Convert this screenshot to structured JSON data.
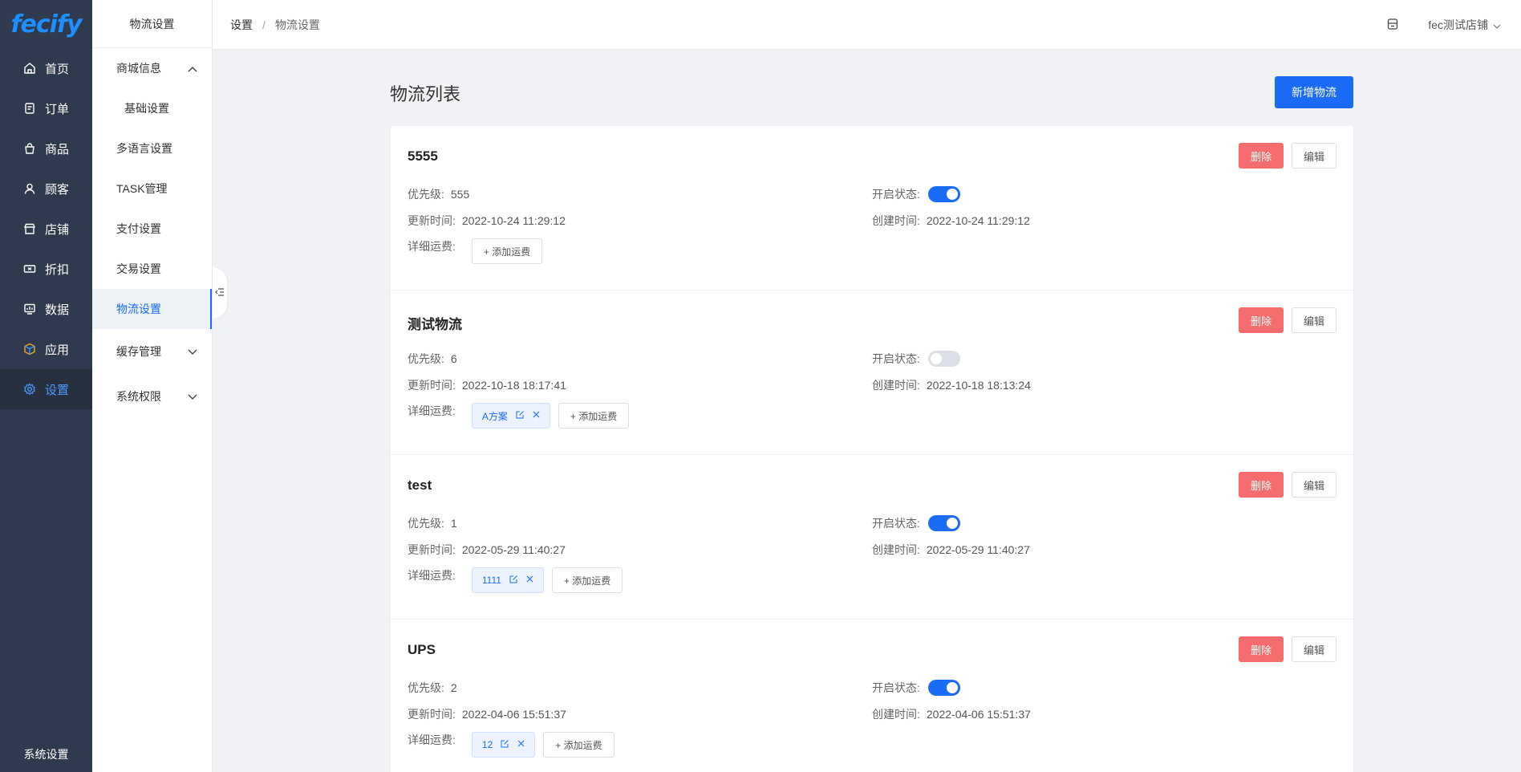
{
  "nav": {
    "logo": "fecify",
    "items": [
      {
        "label": "首页",
        "icon": "home-icon"
      },
      {
        "label": "订单",
        "icon": "order-icon"
      },
      {
        "label": "商品",
        "icon": "bag-icon"
      },
      {
        "label": "顾客",
        "icon": "user-icon"
      },
      {
        "label": "店铺",
        "icon": "store-icon"
      },
      {
        "label": "折扣",
        "icon": "ticket-icon"
      },
      {
        "label": "数据",
        "icon": "chart-icon"
      },
      {
        "label": "应用",
        "icon": "box-icon"
      },
      {
        "label": "设置",
        "icon": "gear-icon"
      }
    ],
    "bottom": "系统设置"
  },
  "submenu": {
    "title": "物流设置",
    "items": [
      {
        "label": "商城信息"
      },
      {
        "label": "基础设置"
      },
      {
        "label": "多语言设置"
      },
      {
        "label": "TASK管理"
      },
      {
        "label": "支付设置"
      },
      {
        "label": "交易设置"
      },
      {
        "label": "物流设置"
      },
      {
        "label": "缓存管理"
      },
      {
        "label": "系统权限"
      }
    ]
  },
  "breadcrumb": {
    "root": "设置",
    "separator": "/",
    "current": "物流设置"
  },
  "topbar": {
    "store": "fec测试店铺"
  },
  "page": {
    "title": "物流列表",
    "add_button": "新增物流"
  },
  "labels": {
    "priority": "优先级:",
    "status": "开启状态:",
    "updated": "更新时间:",
    "created": "创建时间:",
    "shipping": "详细运费:",
    "delete": "删除",
    "edit": "编辑",
    "add_fee": "+ 添加运费"
  },
  "cards": [
    {
      "name": "5555",
      "priority": "555",
      "enabled": true,
      "updated": "2022-10-24 11:29:12",
      "created": "2022-10-24 11:29:12",
      "tags": []
    },
    {
      "name": "测试物流",
      "priority": "6",
      "enabled": false,
      "updated": "2022-10-18 18:17:41",
      "created": "2022-10-18 18:13:24",
      "tags": [
        "A方案"
      ]
    },
    {
      "name": "test",
      "priority": "1",
      "enabled": true,
      "updated": "2022-05-29 11:40:27",
      "created": "2022-05-29 11:40:27",
      "tags": [
        "1111"
      ]
    },
    {
      "name": "UPS",
      "priority": "2",
      "enabled": true,
      "updated": "2022-04-06 15:51:37",
      "created": "2022-04-06 15:51:37",
      "tags": [
        "12"
      ]
    }
  ]
}
